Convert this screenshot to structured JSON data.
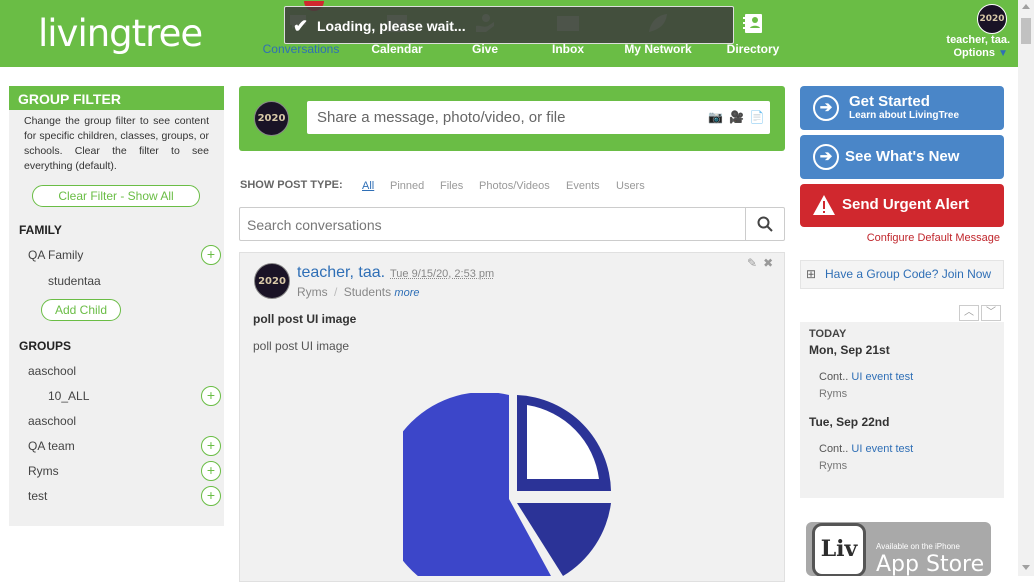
{
  "header": {
    "logo": "livingtree",
    "loading_text": "Loading, please wait...",
    "nav": [
      {
        "label": "Conversations"
      },
      {
        "label": "Calendar"
      },
      {
        "label": "Give"
      },
      {
        "label": "Inbox"
      },
      {
        "label": "My Network"
      },
      {
        "label": "Directory"
      }
    ],
    "user_name": "teacher, taa.",
    "user_options": "Options",
    "avatar_text": "2020"
  },
  "sidebar": {
    "title": "GROUP FILTER",
    "description": "Change the group filter to see content for specific children, classes, groups, or schools. Clear the filter to see everything (default).",
    "clear_filter": "Clear Filter - Show All",
    "family_title": "FAMILY",
    "family_items": [
      "QA Family",
      "studentaa"
    ],
    "add_child": "Add Child",
    "groups_title": "GROUPS",
    "groups": [
      "aaschool",
      "10_ALL",
      "aaschool",
      "QA team",
      "Ryms",
      "test"
    ]
  },
  "composer": {
    "placeholder": "Share a message, photo/video, or file"
  },
  "post_types": {
    "label": "SHOW POST TYPE:",
    "items": [
      "All",
      "Pinned",
      "Files",
      "Photos/Videos",
      "Events",
      "Users"
    ]
  },
  "search": {
    "placeholder": "Search conversations"
  },
  "post": {
    "author": "teacher, taa.",
    "date": "Tue 9/15/20, 2:53 pm",
    "group1": "Ryms",
    "separator": "/",
    "group2": "Students",
    "more": "more",
    "title": "poll post UI image",
    "body": "poll post UI image",
    "pie_colors": [
      "#3c46c9",
      "#2b3397"
    ]
  },
  "right": {
    "get_started": "Get Started",
    "get_started_sub": "Learn about LivingTree",
    "whats_new": "See What's New",
    "urgent": "Send Urgent Alert",
    "configure": "Configure Default Message",
    "group_code": "Have a Group Code? Join Now",
    "calendar": {
      "today": "TODAY",
      "days": [
        {
          "date": "Mon, Sep 21st",
          "prefix": "Cont..",
          "event": "UI event test",
          "group": "Ryms"
        },
        {
          "date": "Tue, Sep 22nd",
          "prefix": "Cont..",
          "event": "UI event test",
          "group": "Ryms"
        }
      ]
    },
    "appstore_small": "Available on the iPhone",
    "appstore_big": "App Store",
    "appstore_logo": "Liv"
  },
  "colors": {
    "brand_green": "#6abd45",
    "blue": "#4a86c8",
    "red": "#d0282e",
    "link": "#2f6fb6"
  }
}
